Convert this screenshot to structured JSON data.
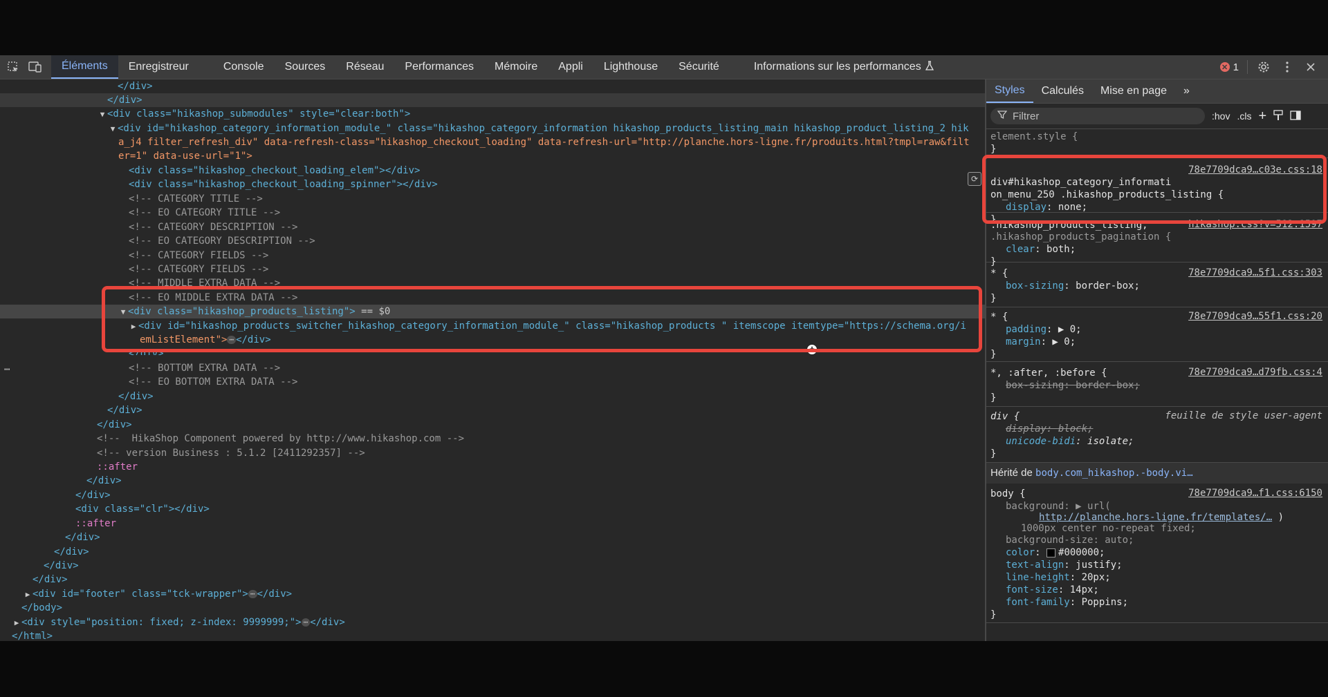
{
  "toolbar": {
    "tabs": [
      "Éléments",
      "Enregistreur",
      "Console",
      "Sources",
      "Réseau",
      "Performances",
      "Mémoire",
      "Appli",
      "Lighthouse",
      "Sécurité",
      "Informations sur les performances"
    ],
    "active_tab": "Éléments",
    "error_count": "1"
  },
  "elements": {
    "lines": [
      "</div>",
      "</div>",
      "<div class=\"hikashop_submodules\" style=\"clear:both\">",
      "<div id=\"hikashop_category_information_module_\" class=\"hikashop_category_information hikashop_products_listing_main hikashop_product_listing_2 hik",
      "a_j4 filter_refresh_div\" data-refresh-class=\"hikashop_checkout_loading\" data-refresh-url=\"http://planche.hors-ligne.fr/produits.html?tmpl=raw&filt",
      "er=1\" data-use-url=\"1\">",
      "<div class=\"hikashop_checkout_loading_elem\"></div>",
      "<div class=\"hikashop_checkout_loading_spinner\"></div>",
      "<!-- CATEGORY TITLE -->",
      "<!-- EO CATEGORY TITLE -->",
      "<!-- CATEGORY DESCRIPTION -->",
      "<!-- EO CATEGORY DESCRIPTION -->",
      "<!-- CATEGORY FIELDS -->",
      "<!-- CATEGORY FIELDS -->",
      "<!-- MIDDLE EXTRA DATA -->",
      "<!-- EO MIDDLE EXTRA DATA -->",
      "<div class=\"hikashop_products_listing\">",
      "== $0",
      "<div id=\"hikashop_products_switcher_hikashop_category_information_module_\" class=\"hikashop_products \" itemscope itemtype=\"https://schema.org/i",
      "emListElement\">",
      "</div>",
      "</div>",
      "<!-- BOTTOM EXTRA DATA -->",
      "<!-- EO BOTTOM EXTRA DATA -->",
      "</div>",
      "</div>",
      "</div>",
      "<!--  HikaShop Component powered by http://www.hikashop.com -->",
      "<!-- version Business : 5.1.2 [2411292357] -->",
      "::after",
      "</div>",
      "</div>",
      "<div class=\"clr\"></div>",
      "::after",
      "</div>",
      "</div>",
      "</div>",
      "</div>",
      "<div id=\"footer\" class=\"tck-wrapper\">",
      "</div>",
      "</body>",
      "<div style=\"position: fixed; z-index: 9999999;\">",
      "</div>",
      "</html>"
    ]
  },
  "styles": {
    "tabs": [
      "Styles",
      "Calculés",
      "Mise en page"
    ],
    "active_tab": "Styles",
    "filter_placeholder": "Filtrer",
    "hov": ":hov",
    "cls": ".cls",
    "rules": [
      {
        "selector": "element.style {",
        "close": "}"
      },
      {
        "selector_1": "div#hikashop_category_informati",
        "selector_2": "on_menu_250 .hikashop_products_listing {",
        "source": "78e7709dca9…c03e.css:18",
        "prop": "display",
        "value": "none;",
        "close": "}"
      },
      {
        "selector_1": ".hikashop_products_listing,",
        "selector_2": ".hikashop_products_pagination {",
        "source": "hikashop.css?v=512:1597",
        "prop": "clear",
        "value": "both;",
        "close": "}"
      },
      {
        "selector": "* {",
        "source": "78e7709dca9…5f1.css:303",
        "prop": "box-sizing",
        "value": "border-box;",
        "close": "}"
      },
      {
        "selector": "* {",
        "source": "78e7709dca9…55f1.css:20",
        "props": [
          {
            "prop": "padding",
            "value": "0;"
          },
          {
            "prop": "margin",
            "value": "0;"
          }
        ],
        "close": "}"
      },
      {
        "selector": "*, :after, :before {",
        "source": "78e7709dca9…d79fb.css:4",
        "prop": "box-sizing",
        "value": "border-box;",
        "close": "}"
      },
      {
        "selector": "div {",
        "source": "feuille de style user-agent",
        "props": [
          {
            "prop": "display",
            "value": "block;"
          },
          {
            "prop": "unicode-bidi",
            "value": "isolate;"
          }
        ],
        "close": "}"
      }
    ],
    "inherited_label": "Hérité de",
    "inherited_link": "body.com_hikashop.-body.vi…",
    "body_rule": {
      "selector": "body {",
      "source": "78e7709dca9…f1.css:6150",
      "background": "background",
      "background_url": "http://planche.hors-ligne.fr/templates/…",
      "url_prefix": "url(",
      "url_suffix": ")",
      "background_cont": "1000px center no-repeat fixed;",
      "background_size": "background-size",
      "background_size_val": "auto;",
      "color": "color",
      "color_val": "#000000;",
      "text_align": "text-align",
      "text_align_val": "justify;",
      "line_height": "line-height",
      "line_height_val": "20px;",
      "font_size": "font-size",
      "font_size_val": "14px;",
      "font_family": "font-family",
      "font_family_val": "Poppins;",
      "close": "}"
    }
  },
  "colors": {
    "highlight": "#e8453c",
    "accent": "#8ab4f8"
  }
}
